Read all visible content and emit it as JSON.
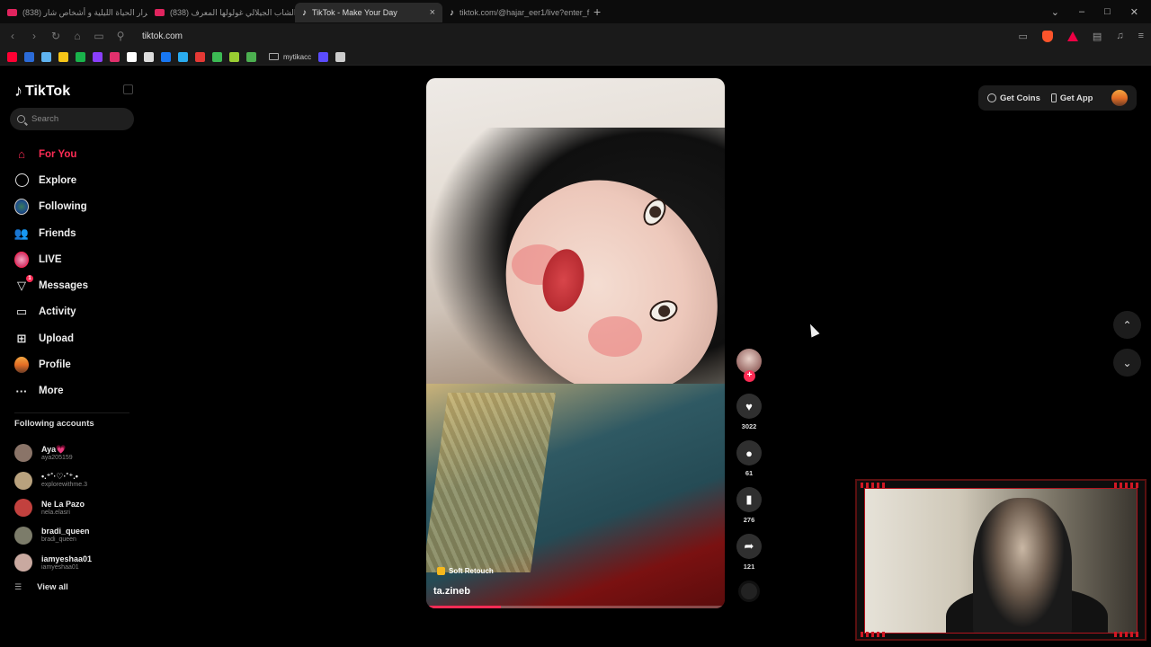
{
  "browser": {
    "tabs": [
      {
        "title": "(838) أسرار الحياة الليلية و أشخاص شار",
        "icon": "youtube-icon",
        "active": false
      },
      {
        "title": "(838) الشاب الجيلالي غولولها المعرف",
        "icon": "youtube-icon",
        "active": false
      },
      {
        "title": "TikTok - Make Your Day",
        "icon": "tiktok-icon",
        "active": true
      },
      {
        "title": "tiktok.com/@hajar_eer1/live?enter_f",
        "icon": "tiktok-icon",
        "active": false
      }
    ],
    "url": "tiktok.com",
    "bookmark_folder": "mytikacc",
    "bookmark_colors": [
      "#ff0033",
      "#2b6bd8",
      "#5fb3f0",
      "#f5c518",
      "#19b34b",
      "#8a3ffc",
      "#e1306c",
      "#ffffff",
      "#dddddd",
      "#1877f2",
      "#2aabee",
      "#e53935",
      "#3cba54",
      "#9acd32",
      "#4caf50",
      "#5b4cff",
      "#cccccc"
    ]
  },
  "tiktok": {
    "logo_text": "TikTok",
    "search_placeholder": "Search",
    "menu": [
      {
        "label": "For You",
        "icon": "home-icon",
        "active": true
      },
      {
        "label": "Explore",
        "icon": "compass-icon",
        "active": false
      },
      {
        "label": "Following",
        "icon": "following-avatar-icon",
        "active": false
      },
      {
        "label": "Friends",
        "icon": "friends-icon",
        "active": false
      },
      {
        "label": "LIVE",
        "icon": "live-icon",
        "active": false
      },
      {
        "label": "Messages",
        "icon": "messages-icon",
        "active": false,
        "badge": "1"
      },
      {
        "label": "Activity",
        "icon": "activity-icon",
        "active": false
      },
      {
        "label": "Upload",
        "icon": "upload-icon",
        "active": false
      },
      {
        "label": "Profile",
        "icon": "profile-icon",
        "active": false
      },
      {
        "label": "More",
        "icon": "more-icon",
        "active": false
      }
    ],
    "following_title": "Following accounts",
    "accounts": [
      {
        "name": "Aya💗",
        "handle": "aya205159",
        "color": "#8a7468"
      },
      {
        "name": "•.⁺˚·♡·˚⁺.•",
        "handle": "explorewithme.3",
        "color": "#b9a27e"
      },
      {
        "name": "Ne La Pazo",
        "handle": "nela.elasri",
        "color": "#c2413e"
      },
      {
        "name": "bradi_queen",
        "handle": "bradi_queen",
        "color": "#7c7c6a"
      },
      {
        "name": "iamyeshaa01",
        "handle": "iamyeshaa01",
        "color": "#c9a9a0"
      }
    ],
    "view_all": "View all",
    "top_right": {
      "get_coins": "Get Coins",
      "get_app": "Get App"
    },
    "video": {
      "author": "ta.zineb",
      "effect": "Soft Retouch",
      "progress": 0.25,
      "likes": "3022",
      "comments": "61",
      "saves": "276",
      "shares": "121"
    },
    "colors": {
      "accent": "#fe2c55"
    }
  }
}
